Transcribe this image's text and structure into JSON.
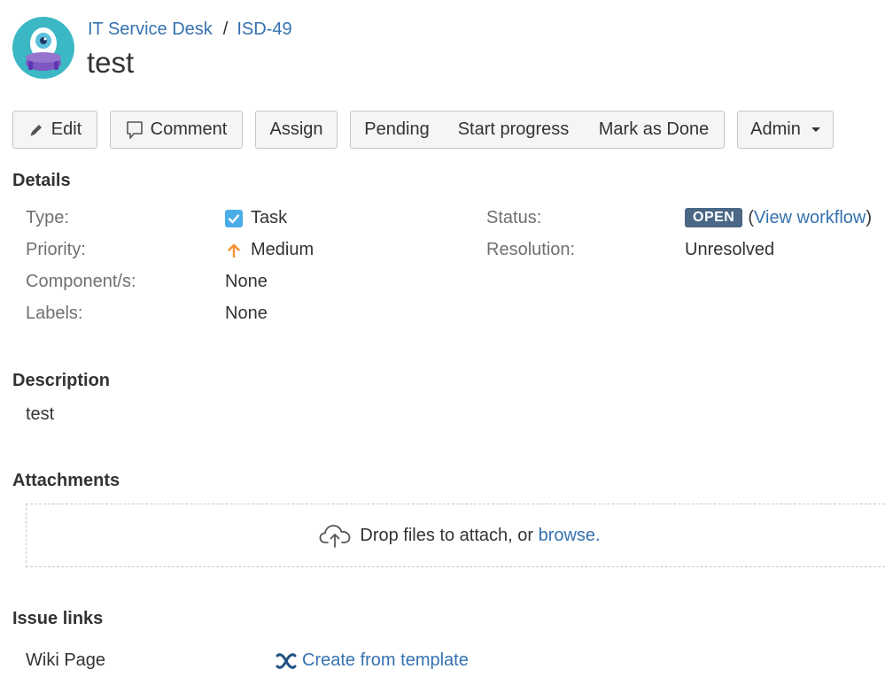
{
  "header": {
    "project": "IT Service Desk",
    "separator": "/",
    "issue_key": "ISD-49",
    "title": "test"
  },
  "toolbar": {
    "edit": "Edit",
    "comment": "Comment",
    "assign": "Assign",
    "pending": "Pending",
    "start_progress": "Start progress",
    "mark_done": "Mark as Done",
    "admin": "Admin"
  },
  "details": {
    "heading": "Details",
    "type_label": "Type:",
    "type_value": "Task",
    "priority_label": "Priority:",
    "priority_value": "Medium",
    "components_label": "Component/s:",
    "components_value": "None",
    "labels_label": "Labels:",
    "labels_value": "None",
    "status_label": "Status:",
    "status_value": "OPEN",
    "view_workflow": "View workflow",
    "paren_open": "(",
    "paren_close": ")",
    "resolution_label": "Resolution:",
    "resolution_value": "Unresolved"
  },
  "description": {
    "heading": "Description",
    "text": "test"
  },
  "attachments": {
    "heading": "Attachments",
    "drop_text": "Drop files to attach, or ",
    "browse": "browse."
  },
  "issue_links": {
    "heading": "Issue links",
    "wiki_label": "Wiki Page",
    "create_from_template": "Create from template"
  },
  "colors": {
    "link": "#3572b0",
    "status_lozenge": "#4a6785",
    "task_icon": "#4bade8",
    "priority_medium": "#f79232",
    "avatar_bg": "#3bb8c3"
  }
}
